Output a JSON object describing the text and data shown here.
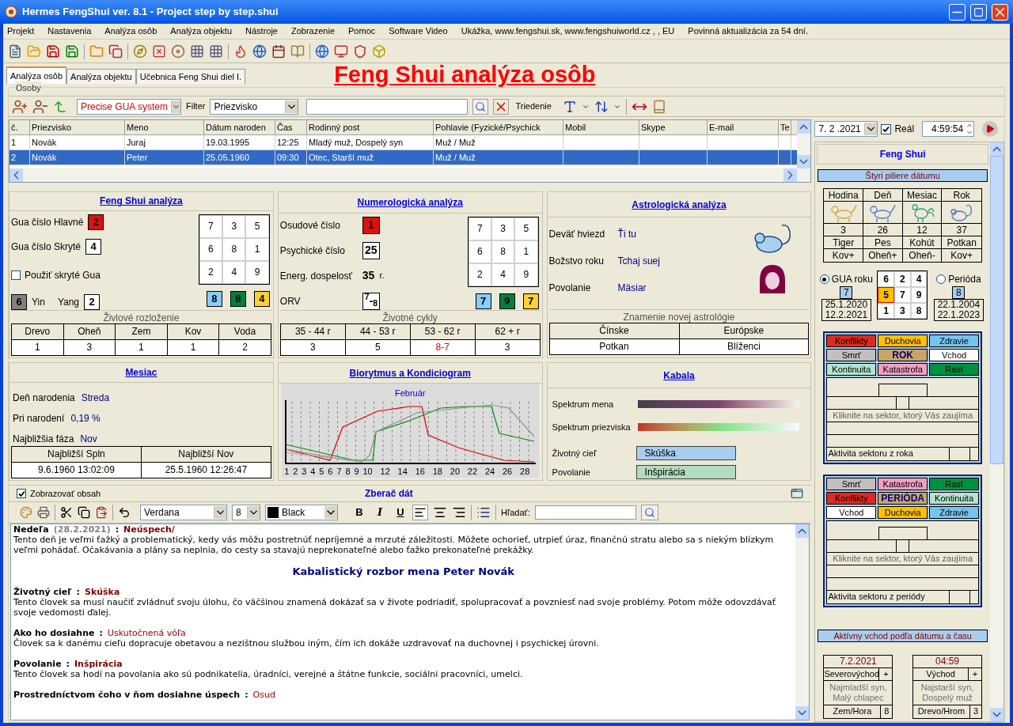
{
  "window": {
    "title": "Hermes FengShui ver. 8.1 - Project step by step.shui"
  },
  "menu": [
    "Projekt",
    "Nastavenia",
    "Analýza osôb",
    "Analýza objektu",
    "Nástroje",
    "Zobrazenie",
    "Pomoc",
    "Software Video",
    "Ukážka, www.fengshui.sk, www.fengshuiworld.cz ,  , EU",
    "Povinná aktualizácia za 54 dní."
  ],
  "tabs": [
    {
      "label": "Analýza osôb",
      "selected": true
    },
    {
      "label": "Analýza objektu",
      "selected": false
    },
    {
      "label": "Učebnica Feng Shui diel I.",
      "selected": false
    }
  ],
  "page_title": "Feng Shui analýza osôb",
  "group_label": "Osoby",
  "person_toolbar": {
    "gua_system": "Precise GUA system",
    "filter_label": "Filter",
    "filter_value": "Priezvisko",
    "sort_label": "Triedenie"
  },
  "table": {
    "columns": [
      "č.",
      "Priezvisko",
      "Meno",
      "Dátum naroden",
      "Čas",
      "Rodinný post",
      "Pohlavie (Fyzické/Psychick",
      "Mobil",
      "Skype",
      "E-mail",
      "Te"
    ],
    "rows": [
      {
        "selected": false,
        "cells": [
          "1",
          "Novák",
          "Juraj",
          "19.03.1995",
          "12:25",
          "Mladý muž, Dospelý syn",
          "Muž / Muž",
          "",
          "",
          "",
          ""
        ]
      },
      {
        "selected": true,
        "cells": [
          "2",
          "Novák",
          "Peter",
          "25.05.1960",
          "09:30",
          "Otec, Starší muž",
          "Muž / Muž",
          "",
          "",
          "",
          ""
        ]
      }
    ]
  },
  "fengshui": {
    "title": "Feng Shui analýza",
    "main_label": "Gua číslo Hlavné",
    "main": {
      "value": "2",
      "color": "#e01010"
    },
    "hidden_label": "Gua číslo Skryté",
    "hidden": {
      "value": "4",
      "color": "#ffffff"
    },
    "use_hidden": {
      "label": "Použiť skryté Gua",
      "checked": false
    },
    "yin": {
      "value": "6",
      "color": "#808080"
    },
    "yin_label": "Yin",
    "yang_label": "Yang",
    "yang": {
      "value": "2",
      "color": "#ffffff"
    },
    "grid": [
      "7",
      "3",
      "5",
      "6",
      "8",
      "1",
      "2",
      "4",
      "9"
    ],
    "chips": [
      {
        "value": "8",
        "color": "#87cefa"
      },
      {
        "value": "8",
        "color": "#008040"
      },
      {
        "value": "4",
        "color": "#ffd030"
      }
    ],
    "section": "Živlové rozloženie",
    "columns": [
      "Drevo",
      "Oheň",
      "Zem",
      "Kov",
      "Voda"
    ],
    "values": [
      "1",
      "3",
      "1",
      "1",
      "2"
    ]
  },
  "numerology": {
    "title": "Numerologická analýza",
    "fields": [
      {
        "label": "Osudové číslo",
        "kind": "box",
        "value": "1",
        "color": "#e01010"
      },
      {
        "label": "Psychické číslo",
        "kind": "box",
        "value": "25",
        "color": "#ffffff"
      },
      {
        "label": "Energ. dospelosť",
        "kind": "plain",
        "value": "35",
        "unit": "r."
      },
      {
        "label": "ORV",
        "kind": "box",
        "value": "$^{7}$-$_{8}$",
        "color": "#ffffff"
      }
    ],
    "grid": [
      "7",
      "3",
      "5",
      "6",
      "8",
      "1",
      "2",
      "4",
      "9"
    ],
    "chips": [
      {
        "value": "7",
        "color": "#87cefa"
      },
      {
        "value": "9",
        "color": "#008040"
      },
      {
        "value": "7",
        "color": "#ffd030"
      }
    ],
    "section": "Životné cykly",
    "columns": [
      "35 - 44 r",
      "44 - 53 r",
      "53 - 62 r",
      "62 + r"
    ],
    "values": [
      {
        "text": "3",
        "highlight": false
      },
      {
        "text": "5",
        "highlight": false
      },
      {
        "text": "8-7",
        "highlight": true
      },
      {
        "text": "3",
        "highlight": false
      }
    ]
  },
  "astrology": {
    "title": "Astrologická analýza",
    "fields": [
      {
        "label": "Deväť hviezd",
        "value": "Ťi tu"
      },
      {
        "label": "Božstvo roku",
        "value": "Tchaj suej"
      },
      {
        "label": "Povolanie",
        "value": "Mäsiar"
      }
    ],
    "section": "Znamenie novej astrológie",
    "columns": [
      "Čínske",
      "Európske"
    ],
    "values": [
      "Potkan",
      "Blíženci"
    ]
  },
  "moon": {
    "title": "Mesiac",
    "fields": [
      {
        "label": "Deň narodenia",
        "value": "Streda"
      },
      {
        "label": "Pri narodení",
        "value": "0,19 %"
      },
      {
        "label": "Najbližšia fáza",
        "value": "Nov"
      }
    ],
    "columns": [
      "Najbližší Spln",
      "Najbližší Nov"
    ],
    "values": [
      "9.6.1960 13:02:09",
      "25.5.1960 12:26:47"
    ]
  },
  "biorhythm": {
    "title": "Biorytmus a Kondiciogram",
    "month": "Február",
    "ticks": [
      "1",
      "2",
      "3",
      "4",
      "5",
      "6",
      "7",
      "8",
      "9",
      "10",
      "12",
      "14",
      "16",
      "18",
      "20",
      "22",
      "24",
      "26",
      "28"
    ]
  },
  "kabala": {
    "title": "Kabala",
    "spectra": [
      {
        "label": "Spektrum mena",
        "kind": "name"
      },
      {
        "label": "Spektrum priezviska",
        "kind": "surname"
      }
    ],
    "fields": [
      {
        "label": "Životný cieľ",
        "value": "Skúška",
        "color": "#a8cdf0"
      },
      {
        "label": "Povolanie",
        "value": "Inšpirácia",
        "color": "#b4dcc0"
      }
    ]
  },
  "editor": {
    "show_content": {
      "label": "Zobrazovať obsah",
      "checked": true
    },
    "title": "Zberač dát",
    "font": "Verdana",
    "size": "8",
    "color_name": "Black",
    "format_buttons": [
      "B",
      "I",
      "U"
    ],
    "search_label": "Hľadať:",
    "blocks": [
      {
        "kind": "line",
        "parts": [
          {
            "kind": "label",
            "text": "Nedeľa"
          },
          {
            "kind": "date",
            "text": "(28.2.2021)"
          },
          {
            "kind": "label",
            "text": ":"
          },
          {
            "kind": "value",
            "text": "Neúspech/"
          }
        ]
      },
      {
        "kind": "para",
        "text": "Tento deň je veľmi ťažký a problematický, kedy vás môžu postretnúť nepríjemné a mrzuté záležitosti. Môžete ochorieť, utrpieť úraz, finančnú stratu alebo sa s niekým blízkym veľmi pohádať. Očakávania a plány sa neplnia, do cesty sa stavajú neprekonateľné alebo ťažko prekonateľné prekážky."
      },
      {
        "kind": "title",
        "text": "Kabalistický rozbor mena Peter Novák"
      },
      {
        "kind": "line",
        "parts": [
          {
            "kind": "label",
            "text": "Životný cieľ"
          },
          {
            "kind": "label",
            "text": ":"
          },
          {
            "kind": "value",
            "text": "Skúška"
          }
        ]
      },
      {
        "kind": "para",
        "text": "Tento človek sa musí naučiť zvládnuť svoju úlohu, čo väčšinou znamená dokázať sa v živote podriadiť, spolupracovať a povzniesť nad svoje problémy. Potom môže odovzdávať svoje vedomosti ďalej."
      },
      {
        "kind": "line",
        "parts": [
          {
            "kind": "label",
            "text": "Ako ho dosiahne"
          },
          {
            "kind": "label",
            "text": ":"
          },
          {
            "kind": "answer",
            "text": "Uskutočnená vôľa"
          }
        ]
      },
      {
        "kind": "para",
        "text": "Človek sa k danému cieľu dopracuje obetavou a nezištnou službou iným, čím ich dokáže uzdravovať na duchovnej i psychickej úrovni."
      },
      {
        "kind": "line",
        "parts": [
          {
            "kind": "label",
            "text": "Povolanie"
          },
          {
            "kind": "label",
            "text": ":"
          },
          {
            "kind": "value",
            "text": "Inšpirácia"
          }
        ]
      },
      {
        "kind": "para",
        "text": "Tento človek sa hodí na povolania ako sú podnikatelia, úradníci, verejné a štátne funkcie, sociálni pracovníci, umelci."
      },
      {
        "kind": "line",
        "parts": [
          {
            "kind": "label",
            "text": "Prostredníctvom čoho v ňom dosiahne úspech"
          },
          {
            "kind": "label",
            "text": ":"
          },
          {
            "kind": "answer",
            "text": "Osud"
          }
        ]
      }
    ]
  },
  "right": {
    "date": "7. 2 .2021",
    "real": {
      "label": "Reál",
      "checked": true
    },
    "time": "4:59:54",
    "title": "Feng Shui",
    "pillars_title": "Štyri piliere dátumu",
    "pillars": [
      {
        "head": "Hodina",
        "number": "3",
        "name": "Tiger",
        "element": "Kov+"
      },
      {
        "head": "Deň",
        "number": "26",
        "name": "Pes",
        "element": "Oheň+"
      },
      {
        "head": "Mesiac",
        "number": "12",
        "name": "Kohút",
        "element": "Oheň-"
      },
      {
        "head": "Rok",
        "number": "37",
        "name": "Potkan",
        "element": "Kov+"
      }
    ],
    "year": {
      "label": "GUA roku",
      "selected": true,
      "number": "7",
      "dates": [
        "25.1.2020",
        "12.2.2021"
      ]
    },
    "period": {
      "label": "Perióda",
      "selected": false,
      "number": "8",
      "dates": [
        "22.1.2004",
        "22.1.2023"
      ]
    },
    "gua_grid": [
      {
        "value": "6",
        "selected": false
      },
      {
        "value": "2",
        "selected": false
      },
      {
        "value": "4",
        "selected": false
      },
      {
        "value": "5",
        "selected": true
      },
      {
        "value": "7",
        "selected": false
      },
      {
        "value": "9",
        "selected": false
      },
      {
        "value": "1",
        "selected": false
      },
      {
        "value": "3",
        "selected": false
      },
      {
        "value": "8",
        "selected": false
      }
    ],
    "sector_boxes": [
      {
        "sectors": [
          {
            "label": "Konflikty",
            "color": "#dd2a22",
            "kind": "sector"
          },
          {
            "label": "Duchovia",
            "color": "#ffc000",
            "kind": "sector"
          },
          {
            "label": "Zdravie",
            "color": "#74c4ee",
            "kind": "sector"
          },
          {
            "label": "Smrť",
            "color": "#c0c0c0",
            "kind": "sector"
          },
          {
            "label": "ROK",
            "color": "#c8a468",
            "kind": "center"
          },
          {
            "label": "Vchod",
            "color": "#ffffff",
            "kind": "sector"
          },
          {
            "label": "Kontinuita",
            "color": "#b4e4cc",
            "kind": "sector"
          },
          {
            "label": "Katastrofa",
            "color": "#f0a0c0",
            "kind": "sector"
          },
          {
            "label": "Rast",
            "color": "#009040",
            "kind": "sector"
          }
        ],
        "hint": "Kliknite na sektor, ktorý Vás zaujíma",
        "footer": "Aktivita sektoru z roka"
      },
      {
        "sectors": [
          {
            "label": "Smrť",
            "color": "#c0c0c0",
            "kind": "sector"
          },
          {
            "label": "Katastrofa",
            "color": "#f0a0c0",
            "kind": "sector"
          },
          {
            "label": "Rast",
            "color": "#009040",
            "kind": "sector"
          },
          {
            "label": "Konflikty",
            "color": "#dd2a22",
            "kind": "sector"
          },
          {
            "label": "PERIÓDA",
            "color": "#c8a468",
            "kind": "center"
          },
          {
            "label": "Kontinuita",
            "color": "#b4e4cc",
            "kind": "sector"
          },
          {
            "label": "Vchod",
            "color": "#ffffff",
            "kind": "sector"
          },
          {
            "label": "Duchovia",
            "color": "#ffc000",
            "kind": "sector"
          },
          {
            "label": "Zdravie",
            "color": "#74c4ee",
            "kind": "sector"
          }
        ],
        "hint": "Kliknite na sektor, ktorý Vás zaujíma",
        "footer": "Aktivita sektoru z periódy"
      }
    ],
    "entrance_title": "Aktívny vchod podľa dátumu a času",
    "entrances": [
      {
        "when": "7.2.2021",
        "direction": "Severovýchod",
        "plus": "+",
        "people": "Najmladší syn, Malý chlapec",
        "element": "Zem/Hora",
        "number": "8"
      },
      {
        "when": "04:59",
        "direction": "Východ",
        "plus": "+",
        "people": "Najstarší syn, Dospelý muž",
        "element": "Drevo/Hrom",
        "number": "3"
      }
    ]
  }
}
